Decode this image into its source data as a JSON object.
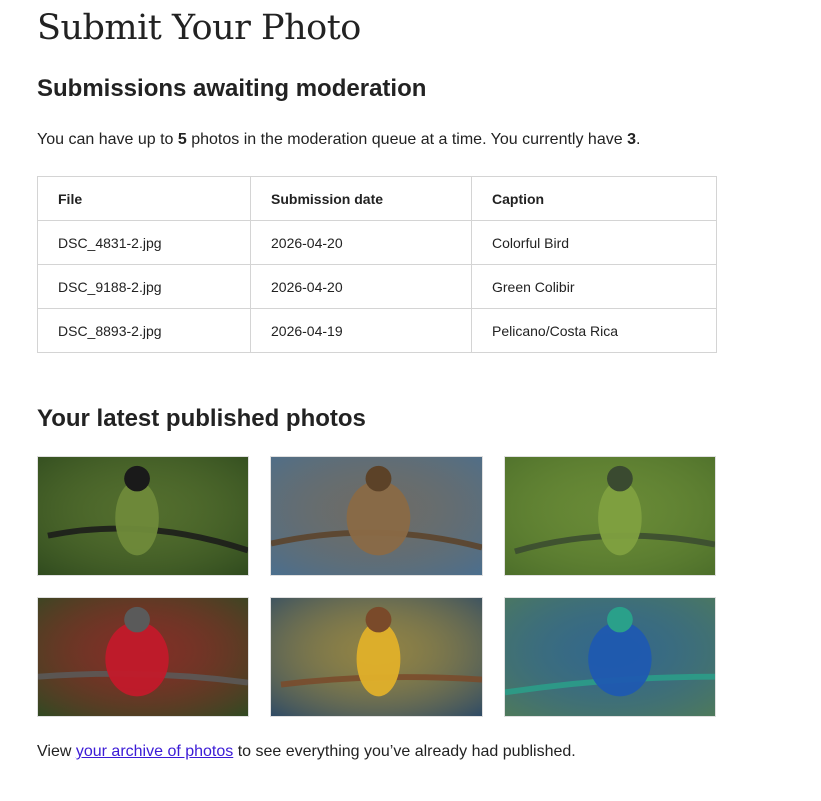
{
  "site_title": "Submit Your Photo",
  "queue_section": {
    "heading": "Submissions awaiting moderation",
    "intro": {
      "prefix": "You can have up to ",
      "max_count": "5",
      "middle": " photos in the moderation queue at a time. You currently have ",
      "current_count": "3",
      "suffix": "."
    },
    "table": {
      "headers": [
        "File",
        "Submission date",
        "Caption"
      ],
      "rows": [
        {
          "file": "DSC_4831-2.jpg",
          "date": "2026-04-20",
          "caption": "Colorful Bird"
        },
        {
          "file": "DSC_9188-2.jpg",
          "date": "2026-04-20",
          "caption": "Green Colibir"
        },
        {
          "file": "DSC_8893-2.jpg",
          "date": "2026-04-19",
          "caption": "Pelicano/Costa Rica"
        }
      ]
    }
  },
  "published_section": {
    "heading": "Your latest published photos",
    "photos": [
      {
        "icon": "bird-photo-black-and-white",
        "colors": [
          "#2f4a1e",
          "#6f8a3a",
          "#1a1a1a"
        ]
      },
      {
        "icon": "bird-photo-owl-brown",
        "colors": [
          "#4a6f8f",
          "#8a6a46",
          "#5c4228"
        ]
      },
      {
        "icon": "bird-photo-green-hummingbird",
        "colors": [
          "#4c6e2a",
          "#7fa040",
          "#3a4a30"
        ]
      },
      {
        "icon": "bird-photo-red-throat-hummingbird",
        "colors": [
          "#2f4a22",
          "#c21a2a",
          "#5a5a5a"
        ]
      },
      {
        "icon": "bird-photo-yellow-breast",
        "colors": [
          "#2d4a66",
          "#e0b02a",
          "#7a4a2a"
        ]
      },
      {
        "icon": "bird-photo-blue-hummingbird",
        "colors": [
          "#4f7a5a",
          "#1f5ab0",
          "#2aa08a"
        ]
      }
    ]
  },
  "footer": {
    "prefix": "View ",
    "link_text": "your archive of photos",
    "suffix": " to see everything you’ve already had published."
  }
}
